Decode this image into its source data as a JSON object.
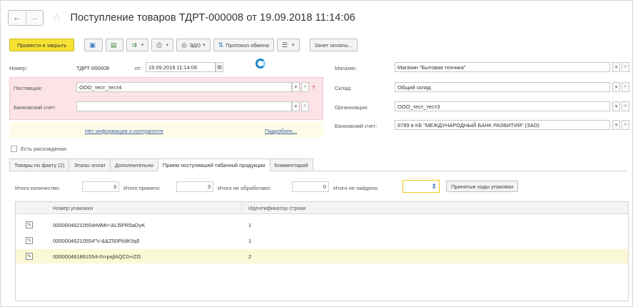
{
  "header": {
    "back_icon": "←",
    "forward_icon": "→",
    "favorite_icon": "☆",
    "title": "Поступление товаров ТДРТ-000008 от 19.09.2018 11:14:06"
  },
  "toolbar": {
    "post_close": "Провести и закрыть",
    "edo": "ЭДО",
    "protocol": "Протокол обмена",
    "offset": "Зачет оплаты..."
  },
  "form": {
    "number_label": "Номер:",
    "number_value": "ТДРТ-000008",
    "from_label": "от:",
    "date_value": "19.09.2018 11:14:06",
    "supplier_label": "Поставщик:",
    "supplier_value": "ООО_тест_тест4",
    "bank_label": "Банковский счет:",
    "bank_value": "",
    "no_info": "Нет информации о контрагенте",
    "more": "Подробнее...",
    "shop_label": "Магазин:",
    "shop_value": "Магазин \"Бытовая техника\"",
    "warehouse_label": "Склад:",
    "warehouse_value": "Общий склад",
    "org_label": "Организация:",
    "org_value": "ООО_тест_тест3",
    "bank2_label": "Банковский счет:",
    "bank2_value": "6789 в КБ \"МЕЖДУНАРОДНЫЙ БАНК РАЗВИТИЯ\" (ЗАО)",
    "discrepancy": "Есть расхождения"
  },
  "tabs": [
    {
      "label": "Товары по факту (2)"
    },
    {
      "label": "Этапы оплат"
    },
    {
      "label": "Дополнительно"
    },
    {
      "label": "Прием поступившей табачной продукции"
    },
    {
      "label": "Комментарий"
    }
  ],
  "totals": {
    "qty_label": "Итого количество:",
    "qty_value": "3",
    "accepted_label": "Итого принято:",
    "accepted_value": "3",
    "unprocessed_label": "Итого не обработано:",
    "unprocessed_value": "0",
    "notfound_label": "Итого не найдено:",
    "notfound_value": "",
    "codes_button": "Принятые коды упаковки"
  },
  "table": {
    "col1": "Номер упаковки",
    "col2": "Идентификатор строки",
    "rows": [
      {
        "code": "00000046210554rMMt>'ALl5PR5aDyK",
        "id": "1"
      },
      {
        "code": "00000046210554\"V-&&Z50Pl/dK5q5",
        "id": "1"
      },
      {
        "code": "000000461861554<h>pxjlAQC0+iZG",
        "id": "2"
      }
    ]
  }
}
